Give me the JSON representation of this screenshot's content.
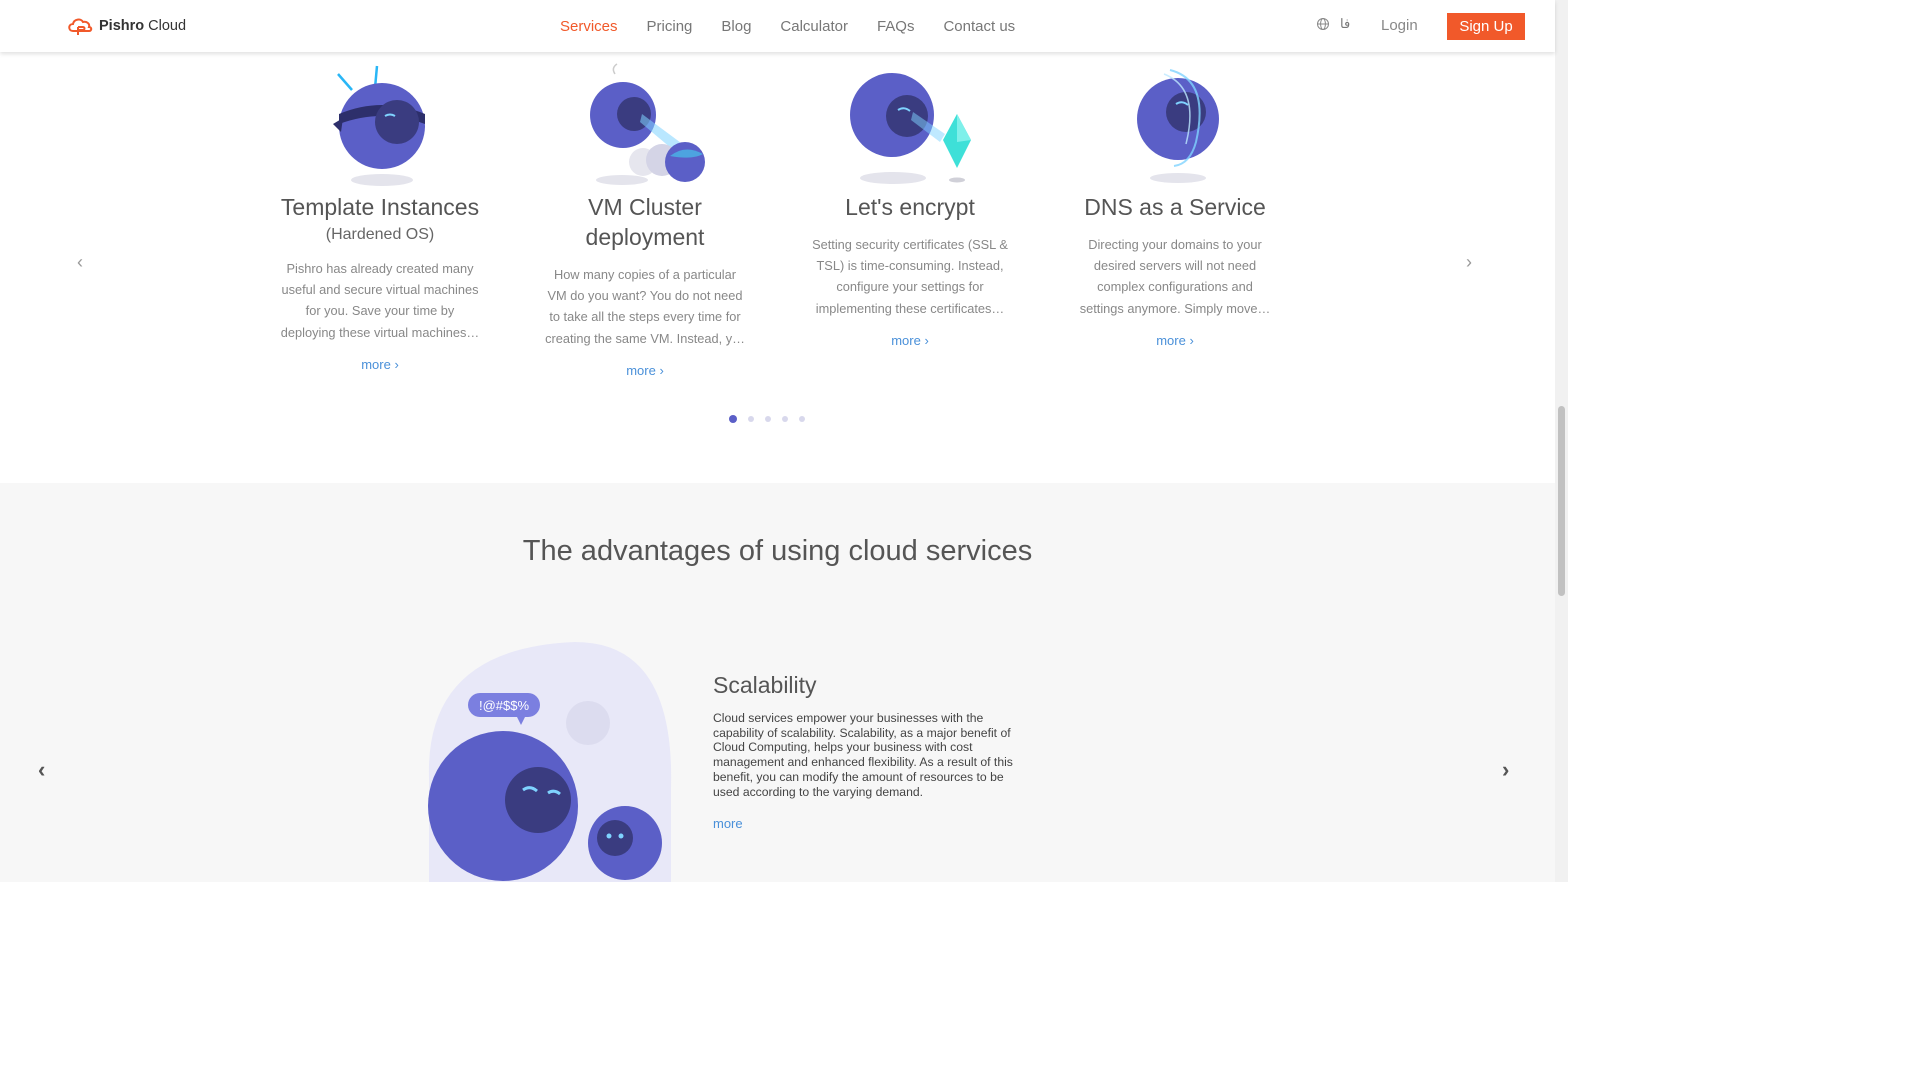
{
  "header": {
    "brand_bold": "Pishro",
    "brand_rest": " Cloud",
    "nav": [
      "Services",
      "Pricing",
      "Blog",
      "Calculator",
      "FAQs",
      "Contact us"
    ],
    "lang": "فا",
    "login": "Login",
    "signup": "Sign Up"
  },
  "services": {
    "prev_icon": "‹",
    "next_icon": "›",
    "cards": [
      {
        "title": "Template Instances",
        "subtitle": "(Hardened OS)",
        "desc": "Pishro has already created many useful and secure virtual machines for you. Save your time by deploying these virtual machines…",
        "more": "more ›"
      },
      {
        "title": "VM Cluster deployment",
        "subtitle": "",
        "desc": "How many copies of a particular VM do you want? You do not need to take all the steps every time for creating the same VM. Instead, y…",
        "more": "more ›"
      },
      {
        "title": "Let's encrypt",
        "subtitle": "",
        "desc": "Setting security certificates (SSL & TSL) is time-consuming. Instead, configure your settings for implementing these certificates…",
        "more": "more ›"
      },
      {
        "title": "DNS as a Service",
        "subtitle": "",
        "desc": "Directing your domains to your desired servers will not need complex configurations and settings anymore. Simply move…",
        "more": "more ›"
      }
    ],
    "active_dot": 0,
    "dot_count": 5
  },
  "advantages": {
    "heading": "The advantages of using cloud services",
    "item": {
      "title": "Scalability",
      "text": "Cloud services empower your businesses with the capability of scalability. Scalability, as a major benefit of Cloud Computing, helps your business with cost management and enhanced flexibility. As a result of this benefit, you can modify the amount of resources to be used according to the varying demand.",
      "more": "more",
      "bubble": "!@#$$%"
    },
    "prev_icon": "‹",
    "next_icon": "›"
  },
  "colors": {
    "accent": "#f1592a",
    "link": "#4a90d9",
    "robot": "#5b5fc7"
  }
}
